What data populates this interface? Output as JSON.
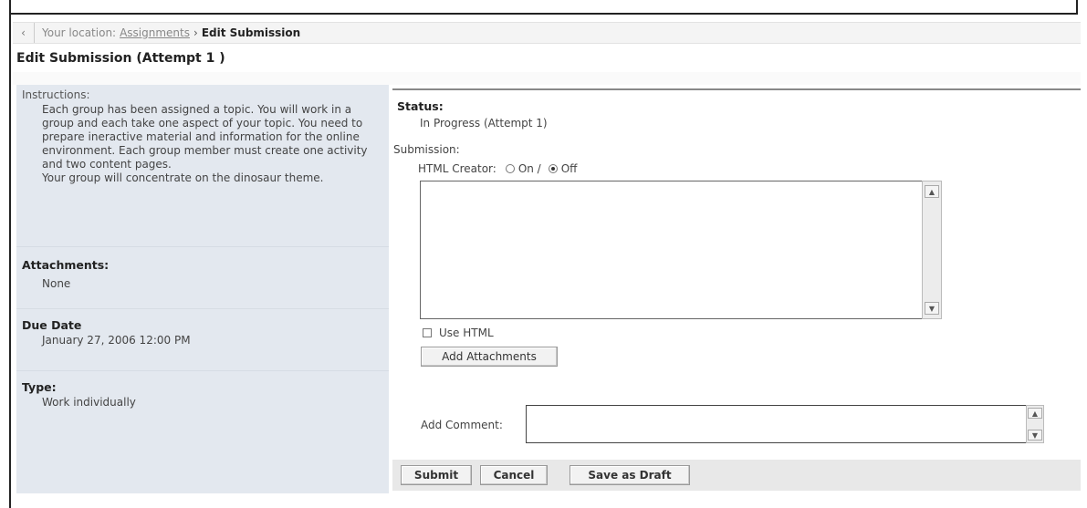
{
  "breadcrumb": {
    "back_icon": "‹",
    "prefix": "Your location:",
    "link": "Assignments",
    "separator": "›",
    "current": "Edit Submission"
  },
  "page": {
    "title": "Edit Submission (Attempt 1 )"
  },
  "left": {
    "instructions_label": "Instructions:",
    "instructions_text": "Each group has been assigned a topic. You will work in a group and each take one aspect of your topic. You need to prepare ineractive material and information for the online environment. Each group member must create one activity and two content pages.",
    "instructions_text2": "Your group will concentrate on the dinosaur theme.",
    "attachments_label": "Attachments:",
    "attachments_value": "None",
    "due_label": "Due Date",
    "due_value": "January 27, 2006 12:00 PM",
    "type_label": "Type:",
    "type_value": "Work individually"
  },
  "right": {
    "status_label": "Status:",
    "status_value": "In Progress (Attempt 1)",
    "submission_label": "Submission:",
    "html_creator_label": "HTML Creator:",
    "on_label": "On /",
    "off_label": "Off",
    "use_html_label": "Use HTML",
    "add_attachments": "Add Attachments",
    "add_comment_label": "Add Comment:"
  },
  "actions": {
    "submit": "Submit",
    "cancel": "Cancel",
    "save_draft": "Save as Draft"
  }
}
